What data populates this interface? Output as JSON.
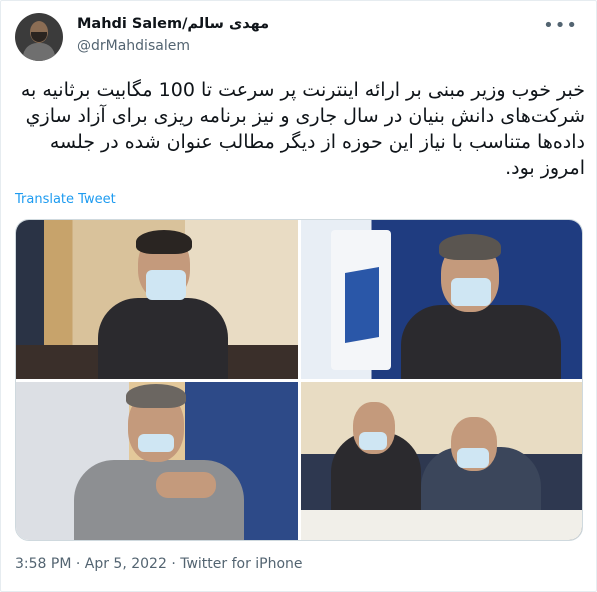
{
  "author": {
    "display_name": "Mahdi Salem/مهدی سالم",
    "handle": "@drMahdisalem"
  },
  "tweet": {
    "text": "خبر خوب وزیر مبنی بر ارائه اینترنت پر سرعت تا 100 مگابیت برثانیه به شرکت‌های دانش بنیان در سال جاری و نیز برنامه ریزی برای آزاد سازي داده‌ها متناسب با نیاز این حوزه از دیگر مطالب عنوان شده در جلسه امروز بود.",
    "translate_label": "Translate Tweet",
    "meta": "3:58 PM · Apr 5, 2022 · Twitter for iPhone"
  },
  "icons": {
    "more": "more-options-icon",
    "avatar": "avatar"
  },
  "colors": {
    "link": "#1d9bf0",
    "secondary_text": "#536471"
  }
}
